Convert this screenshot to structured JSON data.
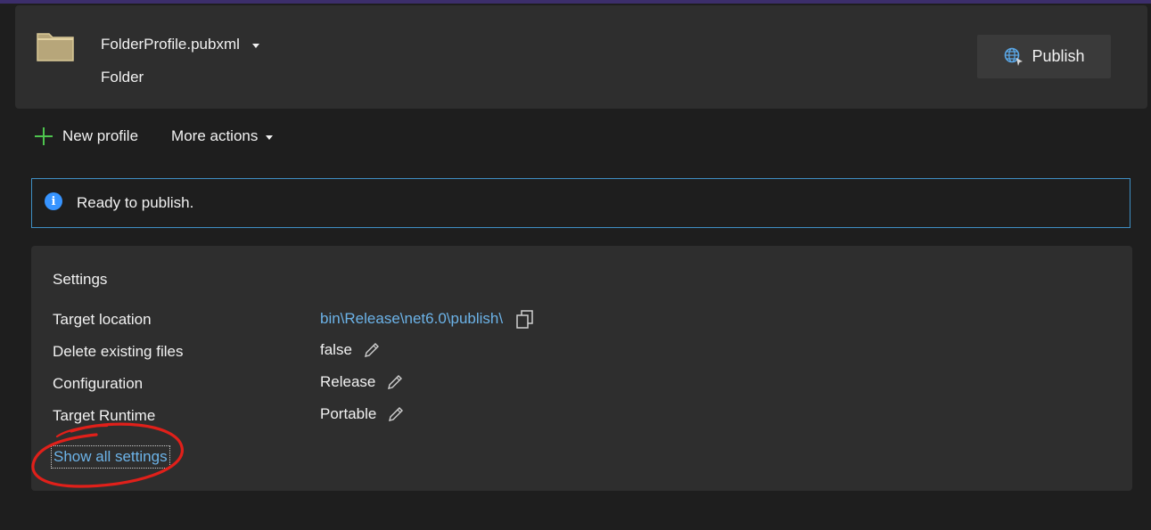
{
  "header": {
    "profile_name": "FolderProfile.pubxml",
    "profile_type": "Folder",
    "publish_label": "Publish"
  },
  "toolbar": {
    "new_profile_label": "New profile",
    "more_actions_label": "More actions"
  },
  "infobar": {
    "message": "Ready to publish."
  },
  "settings": {
    "title": "Settings",
    "rows": [
      {
        "label": "Target location",
        "value": "bin\\Release\\net6.0\\publish\\"
      },
      {
        "label": "Delete existing files",
        "value": "false"
      },
      {
        "label": "Configuration",
        "value": "Release"
      },
      {
        "label": "Target Runtime",
        "value": "Portable"
      }
    ],
    "show_all_label": "Show all settings"
  },
  "colors": {
    "background": "#1e1e1e",
    "card": "#2e2e2e",
    "link": "#6cb3e8",
    "info_border": "#3f8fc4",
    "annotation": "#e0201a",
    "plus_icon": "#4ec44e"
  },
  "icons": [
    "folder-icon",
    "chevron-down-icon",
    "globe-icon",
    "plus-icon",
    "info-icon",
    "copy-icon",
    "pencil-icon"
  ]
}
